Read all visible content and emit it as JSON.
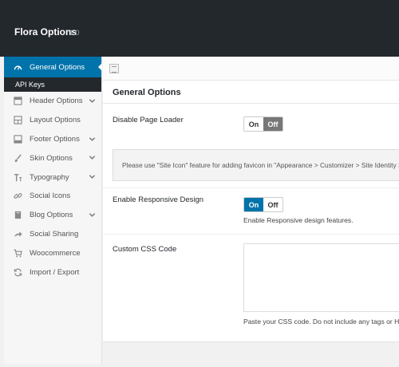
{
  "header": {
    "title": "Flora Options",
    "version": "1.0"
  },
  "sidebar": {
    "items": [
      {
        "label": "General Options",
        "icon": "dashboard-icon",
        "active": true,
        "has_chevron": false
      },
      {
        "label": "Header Options",
        "icon": "header-icon",
        "has_chevron": true
      },
      {
        "label": "Layout Options",
        "icon": "layout-icon",
        "has_chevron": false
      },
      {
        "label": "Footer Options",
        "icon": "footer-icon",
        "has_chevron": true
      },
      {
        "label": "Skin Options",
        "icon": "brush-icon",
        "has_chevron": true
      },
      {
        "label": "Typography",
        "icon": "typography-icon",
        "has_chevron": true
      },
      {
        "label": "Social Icons",
        "icon": "link-icon",
        "has_chevron": false
      },
      {
        "label": "Blog Options",
        "icon": "book-icon",
        "has_chevron": true
      },
      {
        "label": "Social Sharing",
        "icon": "share-icon",
        "has_chevron": false
      },
      {
        "label": "Woocommerce",
        "icon": "cart-icon",
        "has_chevron": false
      },
      {
        "label": "Import / Export",
        "icon": "refresh-icon",
        "has_chevron": false
      }
    ],
    "sub_items": [
      {
        "label": "API Keys",
        "active": true
      }
    ]
  },
  "main": {
    "section_title": "General Options",
    "fields": {
      "page_loader": {
        "label": "Disable Page Loader",
        "on": "On",
        "off": "Off",
        "selected": "Off"
      },
      "notice": "Please use \"Site Icon\" feature for adding favicon in \"Appearance > Customizer > Site Identity > S",
      "responsive": {
        "label": "Enable Responsive Design",
        "on": "On",
        "off": "Off",
        "selected": "On",
        "desc": "Enable Responsive design features."
      },
      "custom_css": {
        "label": "Custom CSS Code",
        "value": "",
        "desc": "Paste your CSS code. Do not include any tags or HTML"
      }
    }
  },
  "colors": {
    "accent": "#0073aa",
    "header_bg": "#23282d",
    "toggle_off_active": "#777777"
  }
}
